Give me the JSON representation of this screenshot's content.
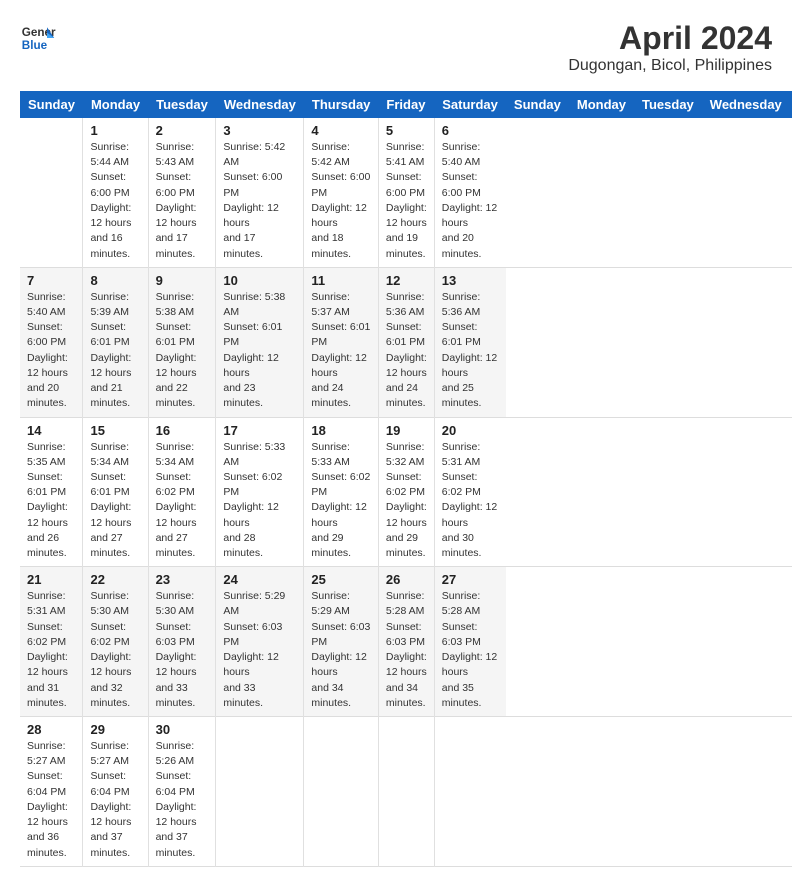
{
  "header": {
    "logo_line1": "General",
    "logo_line2": "Blue",
    "title": "April 2024",
    "subtitle": "Dugongan, Bicol, Philippines"
  },
  "calendar": {
    "days_of_week": [
      "Sunday",
      "Monday",
      "Tuesday",
      "Wednesday",
      "Thursday",
      "Friday",
      "Saturday"
    ],
    "weeks": [
      [
        {
          "day": "",
          "info": ""
        },
        {
          "day": "1",
          "info": "Sunrise: 5:44 AM\nSunset: 6:00 PM\nDaylight: 12 hours\nand 16 minutes."
        },
        {
          "day": "2",
          "info": "Sunrise: 5:43 AM\nSunset: 6:00 PM\nDaylight: 12 hours\nand 17 minutes."
        },
        {
          "day": "3",
          "info": "Sunrise: 5:42 AM\nSunset: 6:00 PM\nDaylight: 12 hours\nand 17 minutes."
        },
        {
          "day": "4",
          "info": "Sunrise: 5:42 AM\nSunset: 6:00 PM\nDaylight: 12 hours\nand 18 minutes."
        },
        {
          "day": "5",
          "info": "Sunrise: 5:41 AM\nSunset: 6:00 PM\nDaylight: 12 hours\nand 19 minutes."
        },
        {
          "day": "6",
          "info": "Sunrise: 5:40 AM\nSunset: 6:00 PM\nDaylight: 12 hours\nand 20 minutes."
        }
      ],
      [
        {
          "day": "7",
          "info": "Sunrise: 5:40 AM\nSunset: 6:00 PM\nDaylight: 12 hours\nand 20 minutes."
        },
        {
          "day": "8",
          "info": "Sunrise: 5:39 AM\nSunset: 6:01 PM\nDaylight: 12 hours\nand 21 minutes."
        },
        {
          "day": "9",
          "info": "Sunrise: 5:38 AM\nSunset: 6:01 PM\nDaylight: 12 hours\nand 22 minutes."
        },
        {
          "day": "10",
          "info": "Sunrise: 5:38 AM\nSunset: 6:01 PM\nDaylight: 12 hours\nand 23 minutes."
        },
        {
          "day": "11",
          "info": "Sunrise: 5:37 AM\nSunset: 6:01 PM\nDaylight: 12 hours\nand 24 minutes."
        },
        {
          "day": "12",
          "info": "Sunrise: 5:36 AM\nSunset: 6:01 PM\nDaylight: 12 hours\nand 24 minutes."
        },
        {
          "day": "13",
          "info": "Sunrise: 5:36 AM\nSunset: 6:01 PM\nDaylight: 12 hours\nand 25 minutes."
        }
      ],
      [
        {
          "day": "14",
          "info": "Sunrise: 5:35 AM\nSunset: 6:01 PM\nDaylight: 12 hours\nand 26 minutes."
        },
        {
          "day": "15",
          "info": "Sunrise: 5:34 AM\nSunset: 6:01 PM\nDaylight: 12 hours\nand 27 minutes."
        },
        {
          "day": "16",
          "info": "Sunrise: 5:34 AM\nSunset: 6:02 PM\nDaylight: 12 hours\nand 27 minutes."
        },
        {
          "day": "17",
          "info": "Sunrise: 5:33 AM\nSunset: 6:02 PM\nDaylight: 12 hours\nand 28 minutes."
        },
        {
          "day": "18",
          "info": "Sunrise: 5:33 AM\nSunset: 6:02 PM\nDaylight: 12 hours\nand 29 minutes."
        },
        {
          "day": "19",
          "info": "Sunrise: 5:32 AM\nSunset: 6:02 PM\nDaylight: 12 hours\nand 29 minutes."
        },
        {
          "day": "20",
          "info": "Sunrise: 5:31 AM\nSunset: 6:02 PM\nDaylight: 12 hours\nand 30 minutes."
        }
      ],
      [
        {
          "day": "21",
          "info": "Sunrise: 5:31 AM\nSunset: 6:02 PM\nDaylight: 12 hours\nand 31 minutes."
        },
        {
          "day": "22",
          "info": "Sunrise: 5:30 AM\nSunset: 6:02 PM\nDaylight: 12 hours\nand 32 minutes."
        },
        {
          "day": "23",
          "info": "Sunrise: 5:30 AM\nSunset: 6:03 PM\nDaylight: 12 hours\nand 33 minutes."
        },
        {
          "day": "24",
          "info": "Sunrise: 5:29 AM\nSunset: 6:03 PM\nDaylight: 12 hours\nand 33 minutes."
        },
        {
          "day": "25",
          "info": "Sunrise: 5:29 AM\nSunset: 6:03 PM\nDaylight: 12 hours\nand 34 minutes."
        },
        {
          "day": "26",
          "info": "Sunrise: 5:28 AM\nSunset: 6:03 PM\nDaylight: 12 hours\nand 34 minutes."
        },
        {
          "day": "27",
          "info": "Sunrise: 5:28 AM\nSunset: 6:03 PM\nDaylight: 12 hours\nand 35 minutes."
        }
      ],
      [
        {
          "day": "28",
          "info": "Sunrise: 5:27 AM\nSunset: 6:04 PM\nDaylight: 12 hours\nand 36 minutes."
        },
        {
          "day": "29",
          "info": "Sunrise: 5:27 AM\nSunset: 6:04 PM\nDaylight: 12 hours\nand 37 minutes."
        },
        {
          "day": "30",
          "info": "Sunrise: 5:26 AM\nSunset: 6:04 PM\nDaylight: 12 hours\nand 37 minutes."
        },
        {
          "day": "",
          "info": ""
        },
        {
          "day": "",
          "info": ""
        },
        {
          "day": "",
          "info": ""
        },
        {
          "day": "",
          "info": ""
        }
      ]
    ]
  }
}
